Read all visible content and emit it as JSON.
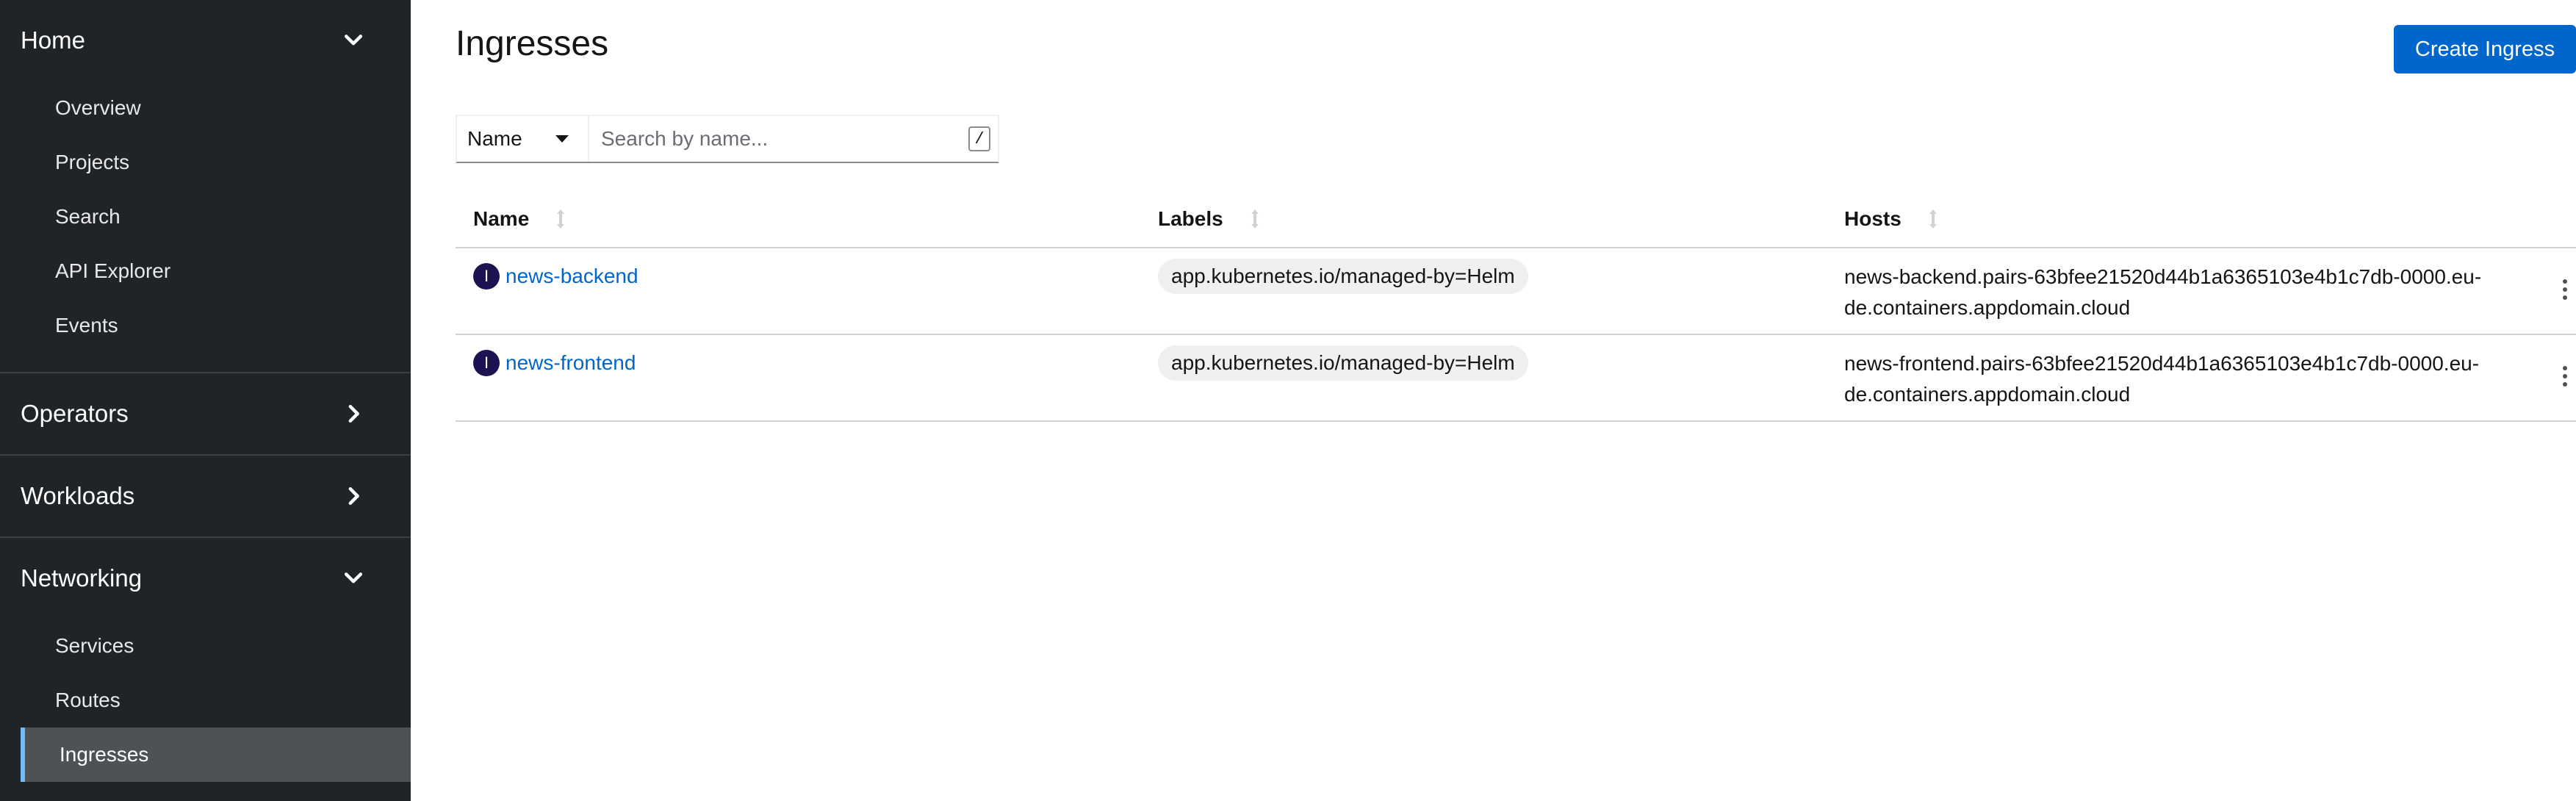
{
  "sidebar": {
    "home": {
      "label": "Home",
      "items": [
        "Overview",
        "Projects",
        "Search",
        "API Explorer",
        "Events"
      ]
    },
    "operators": {
      "label": "Operators"
    },
    "workloads": {
      "label": "Workloads"
    },
    "networking": {
      "label": "Networking",
      "items": [
        "Services",
        "Routes",
        "Ingresses"
      ],
      "active": "Ingresses"
    }
  },
  "page": {
    "title": "Ingresses",
    "create_button": "Create Ingress"
  },
  "filter": {
    "selected": "Name",
    "placeholder": "Search by name...",
    "shortcut": "/"
  },
  "table": {
    "columns": {
      "name": "Name",
      "labels": "Labels",
      "hosts": "Hosts"
    },
    "rows": [
      {
        "badge": "I",
        "name": "news-backend",
        "label": "app.kubernetes.io/managed-by=Helm",
        "hosts": "news-backend.pairs-63bfee21520d44b1a6365103e4b1c7db-0000.eu-de.containers.appdomain.cloud"
      },
      {
        "badge": "I",
        "name": "news-frontend",
        "label": "app.kubernetes.io/managed-by=Helm",
        "hosts": "news-frontend.pairs-63bfee21520d44b1a6365103e4b1c7db-0000.eu-de.containers.appdomain.cloud"
      }
    ]
  },
  "colors": {
    "sidebar_bg": "#212427",
    "primary": "#0066cc",
    "active_nav_bg": "#4f5255",
    "active_nav_border": "#73bcf7",
    "resource_badge": "#1c1450"
  }
}
